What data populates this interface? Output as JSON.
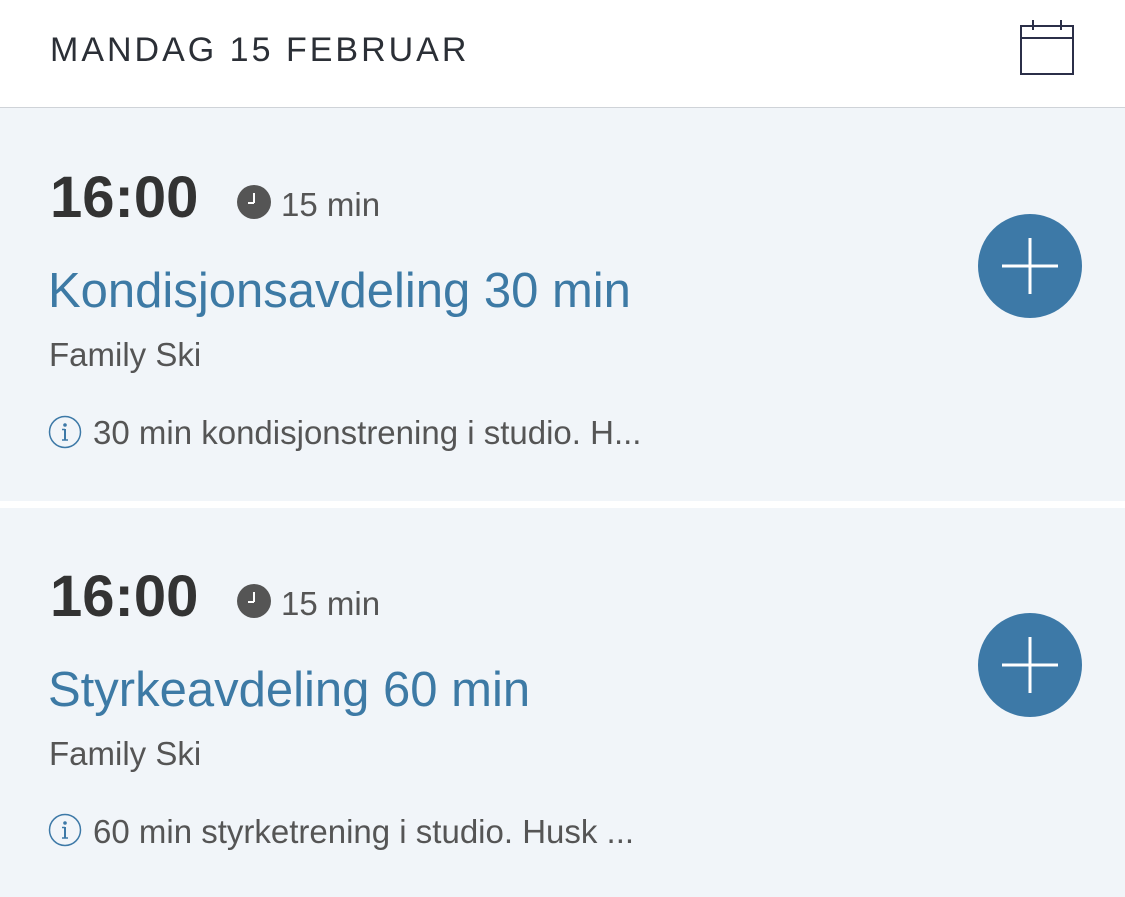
{
  "header": {
    "title": "MANDAG 15 FEBRUAR",
    "calendar_icon": "calendar-icon"
  },
  "colors": {
    "accent": "#3d79a7",
    "card_background": "#f1f5f9",
    "text_dark": "#333333",
    "text_muted": "#555555"
  },
  "sessions": [
    {
      "time": "16:00",
      "duration": "15 min",
      "name": "Kondisjonsavdeling 30 min",
      "location": "Family Ski",
      "description": "30 min kondisjonstrening i studio. H...",
      "add_icon": "plus-icon"
    },
    {
      "time": "16:00",
      "duration": "15 min",
      "name": "Styrkeavdeling 60 min",
      "location": "Family Ski",
      "description": "60 min styrketrening i studio. Husk ...",
      "add_icon": "plus-icon"
    }
  ]
}
